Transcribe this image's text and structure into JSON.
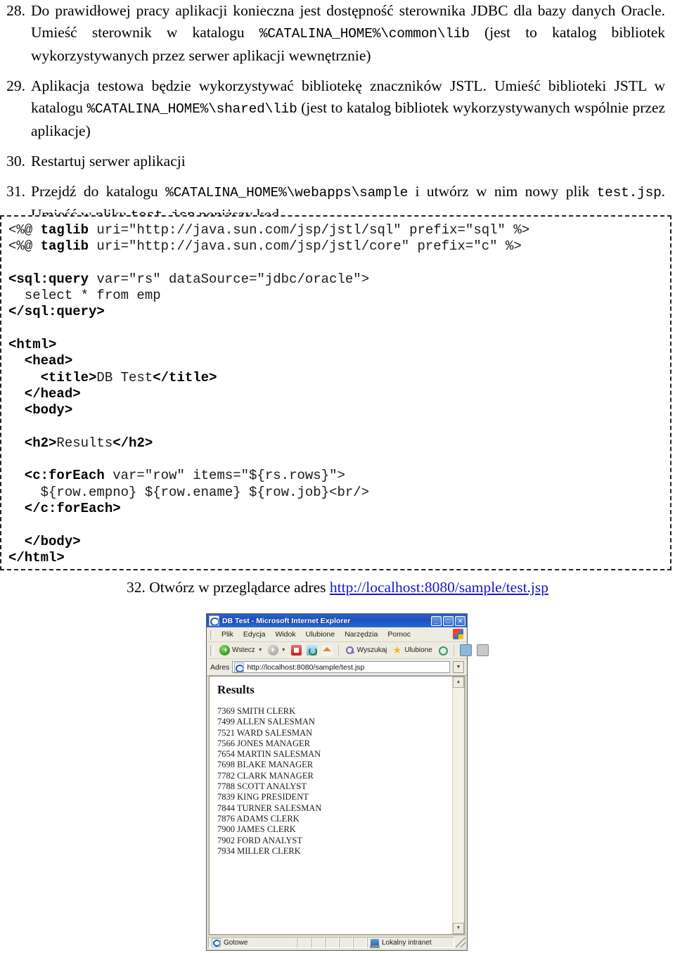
{
  "document": {
    "items": [
      {
        "number": "28.",
        "segments": [
          {
            "type": "text",
            "value": "Do prawidłowej pracy aplikacji konieczna jest dostępność sterownika JDBC dla bazy danych Oracle. Umieść sterownik w katalogu "
          },
          {
            "type": "code",
            "value": "%CATALINA_HOME%\\common\\lib"
          },
          {
            "type": "text",
            "value": " (jest to katalog bibliotek wykorzystywanych przez serwer aplikacji wewnętrznie)"
          }
        ]
      },
      {
        "number": "29.",
        "segments": [
          {
            "type": "text",
            "value": "Aplikacja testowa będzie wykorzystywać bibliotekę znaczników JSTL. Umieść biblioteki JSTL w katalogu "
          },
          {
            "type": "code",
            "value": "%CATALINA_HOME%\\shared\\lib"
          },
          {
            "type": "text",
            "value": " (jest to katalog bibliotek wykorzystywanych wspólnie przez aplikacje)"
          }
        ]
      },
      {
        "number": "30.",
        "segments": [
          {
            "type": "text",
            "value": "Restartuj serwer aplikacji"
          }
        ]
      },
      {
        "number": "31.",
        "segments": [
          {
            "type": "text",
            "value": "Przejdź do katalogu "
          },
          {
            "type": "code",
            "value": "%CATALINA_HOME%\\webapps\\sample"
          },
          {
            "type": "text",
            "value": " i utwórz w nim nowy plik "
          },
          {
            "type": "code",
            "value": "test.jsp"
          },
          {
            "type": "text",
            "value": ". Umieść w pliku "
          },
          {
            "type": "code",
            "value": "test.jsp"
          },
          {
            "type": "text",
            "value": " poniższy kod"
          }
        ]
      }
    ],
    "item32": {
      "number": "32.",
      "text_before": "Otwórz w przeglądarce adres ",
      "link_text": "http://localhost:8080/sample/test.jsp",
      "link_color": "#1616c8"
    }
  },
  "code_listing": {
    "lines": [
      [
        {
          "b": false,
          "t": "<%@ "
        },
        {
          "b": true,
          "t": "taglib"
        },
        {
          "b": false,
          "t": " uri=\"http://java.sun.com/jsp/jstl/sql\" prefix=\"sql\" %>"
        }
      ],
      [
        {
          "b": false,
          "t": "<%@ "
        },
        {
          "b": true,
          "t": "taglib"
        },
        {
          "b": false,
          "t": " uri=\"http://java.sun.com/jsp/jstl/core\" prefix=\"c\" %>"
        }
      ],
      [],
      [
        {
          "b": true,
          "t": "<sql:query"
        },
        {
          "b": false,
          "t": " var=\"rs\" dataSource=\"jdbc/oracle\">"
        }
      ],
      [
        {
          "b": false,
          "t": "  select * from emp"
        }
      ],
      [
        {
          "b": true,
          "t": "</sql:query>"
        }
      ],
      [],
      [
        {
          "b": true,
          "t": "<html>"
        }
      ],
      [
        {
          "b": true,
          "t": "  <head>"
        }
      ],
      [
        {
          "b": true,
          "t": "    <title>"
        },
        {
          "b": false,
          "t": "DB Test"
        },
        {
          "b": true,
          "t": "</title>"
        }
      ],
      [
        {
          "b": true,
          "t": "  </head>"
        }
      ],
      [
        {
          "b": true,
          "t": "  <body>"
        }
      ],
      [],
      [
        {
          "b": true,
          "t": "  <h2>"
        },
        {
          "b": false,
          "t": "Results"
        },
        {
          "b": true,
          "t": "</h2>"
        }
      ],
      [],
      [
        {
          "b": true,
          "t": "  <c:forEach"
        },
        {
          "b": false,
          "t": " var=\"row\" items=\"${rs.rows}\">"
        }
      ],
      [
        {
          "b": false,
          "t": "    ${row.empno} ${row.ename} ${row.job}<br/>"
        }
      ],
      [
        {
          "b": true,
          "t": "  </c:forEach>"
        }
      ],
      [],
      [
        {
          "b": true,
          "t": "  </body>"
        }
      ],
      [
        {
          "b": true,
          "t": "</html>"
        }
      ]
    ]
  },
  "browser": {
    "window_title": "DB Test - Microsoft Internet Explorer",
    "window_buttons": {
      "minimize": "_",
      "maximize": "□",
      "close": "✕"
    },
    "menu": [
      {
        "label": "Plik",
        "accel": "P"
      },
      {
        "label": "Edycja",
        "accel": "E"
      },
      {
        "label": "Widok",
        "accel": "W"
      },
      {
        "label": "Ulubione",
        "accel": "U"
      },
      {
        "label": "Narzędzia",
        "accel": "N"
      },
      {
        "label": "Pomoc",
        "accel": "c"
      }
    ],
    "toolbar": [
      {
        "icon": "back-icon",
        "label": "Wstecz",
        "has_caret": true
      },
      {
        "icon": "forward-icon",
        "label": "",
        "has_caret": true
      },
      {
        "icon": "stop-icon",
        "label": ""
      },
      {
        "icon": "refresh-icon",
        "label": ""
      },
      {
        "icon": "home-icon",
        "label": ""
      },
      {
        "icon": "search-icon",
        "label": "Wyszukaj"
      },
      {
        "icon": "favorites-star-icon",
        "label": "Ulubione"
      },
      {
        "icon": "history-icon",
        "label": ""
      },
      {
        "icon": "mail-icon",
        "label": ""
      },
      {
        "icon": "print-icon",
        "label": ""
      }
    ],
    "address": {
      "label": "Adres",
      "url": "http://localhost:8080/sample/test.jsp"
    },
    "page": {
      "heading": "Results",
      "rows": [
        "7369 SMITH CLERK",
        "7499 ALLEN SALESMAN",
        "7521 WARD SALESMAN",
        "7566 JONES MANAGER",
        "7654 MARTIN SALESMAN",
        "7698 BLAKE MANAGER",
        "7782 CLARK MANAGER",
        "7788 SCOTT ANALYST",
        "7839 KING PRESIDENT",
        "7844 TURNER SALESMAN",
        "7876 ADAMS CLERK",
        "7900 JAMES CLERK",
        "7902 FORD ANALYST",
        "7934 MILLER CLERK"
      ]
    },
    "statusbar": {
      "status": "Gotowe",
      "zone": "Lokalny intranet"
    }
  }
}
